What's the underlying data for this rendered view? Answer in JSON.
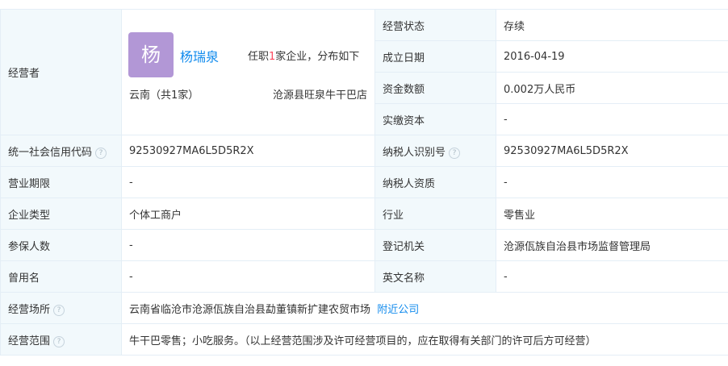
{
  "owner": {
    "label": "经营者",
    "avatar_char": "杨",
    "name": "杨瑞泉",
    "stats_prefix": "任职",
    "stats_count": "1",
    "stats_suffix": "家企业，分布如下",
    "region": "云南（共1家）",
    "shop": "沧源县旺泉牛干巴店"
  },
  "status": {
    "label": "经营状态",
    "value": "存续"
  },
  "founded": {
    "label": "成立日期",
    "value": "2016-04-19"
  },
  "capital": {
    "label": "资金数额",
    "value": "0.002万人民币"
  },
  "paid_capital": {
    "label": "实缴资本",
    "value": "-"
  },
  "credit_code": {
    "label": "统一社会信用代码",
    "value": "92530927MA6L5D5R2X"
  },
  "tax_id": {
    "label": "纳税人识别号",
    "value": "92530927MA6L5D5R2X"
  },
  "term": {
    "label": "营业期限",
    "value": "-"
  },
  "tax_qualification": {
    "label": "纳税人资质",
    "value": "-"
  },
  "company_type": {
    "label": "企业类型",
    "value": "个体工商户"
  },
  "industry": {
    "label": "行业",
    "value": "零售业"
  },
  "insured": {
    "label": "参保人数",
    "value": "-"
  },
  "registrar": {
    "label": "登记机关",
    "value": "沧源佤族自治县市场监督管理局"
  },
  "former_name": {
    "label": "曾用名",
    "value": "-"
  },
  "english_name": {
    "label": "英文名称",
    "value": "-"
  },
  "address": {
    "label": "经营场所",
    "value": "云南省临沧市沧源佤族自治县勐董镇新扩建农贸市场",
    "nearby_link": "附近公司"
  },
  "scope": {
    "label": "经营范围",
    "value": "牛干巴零售；小吃服务。（以上经营范围涉及许可经营项目的，应在取得有关部门的许可后方可经营）"
  },
  "icons": {
    "help": "question-circle-icon"
  }
}
